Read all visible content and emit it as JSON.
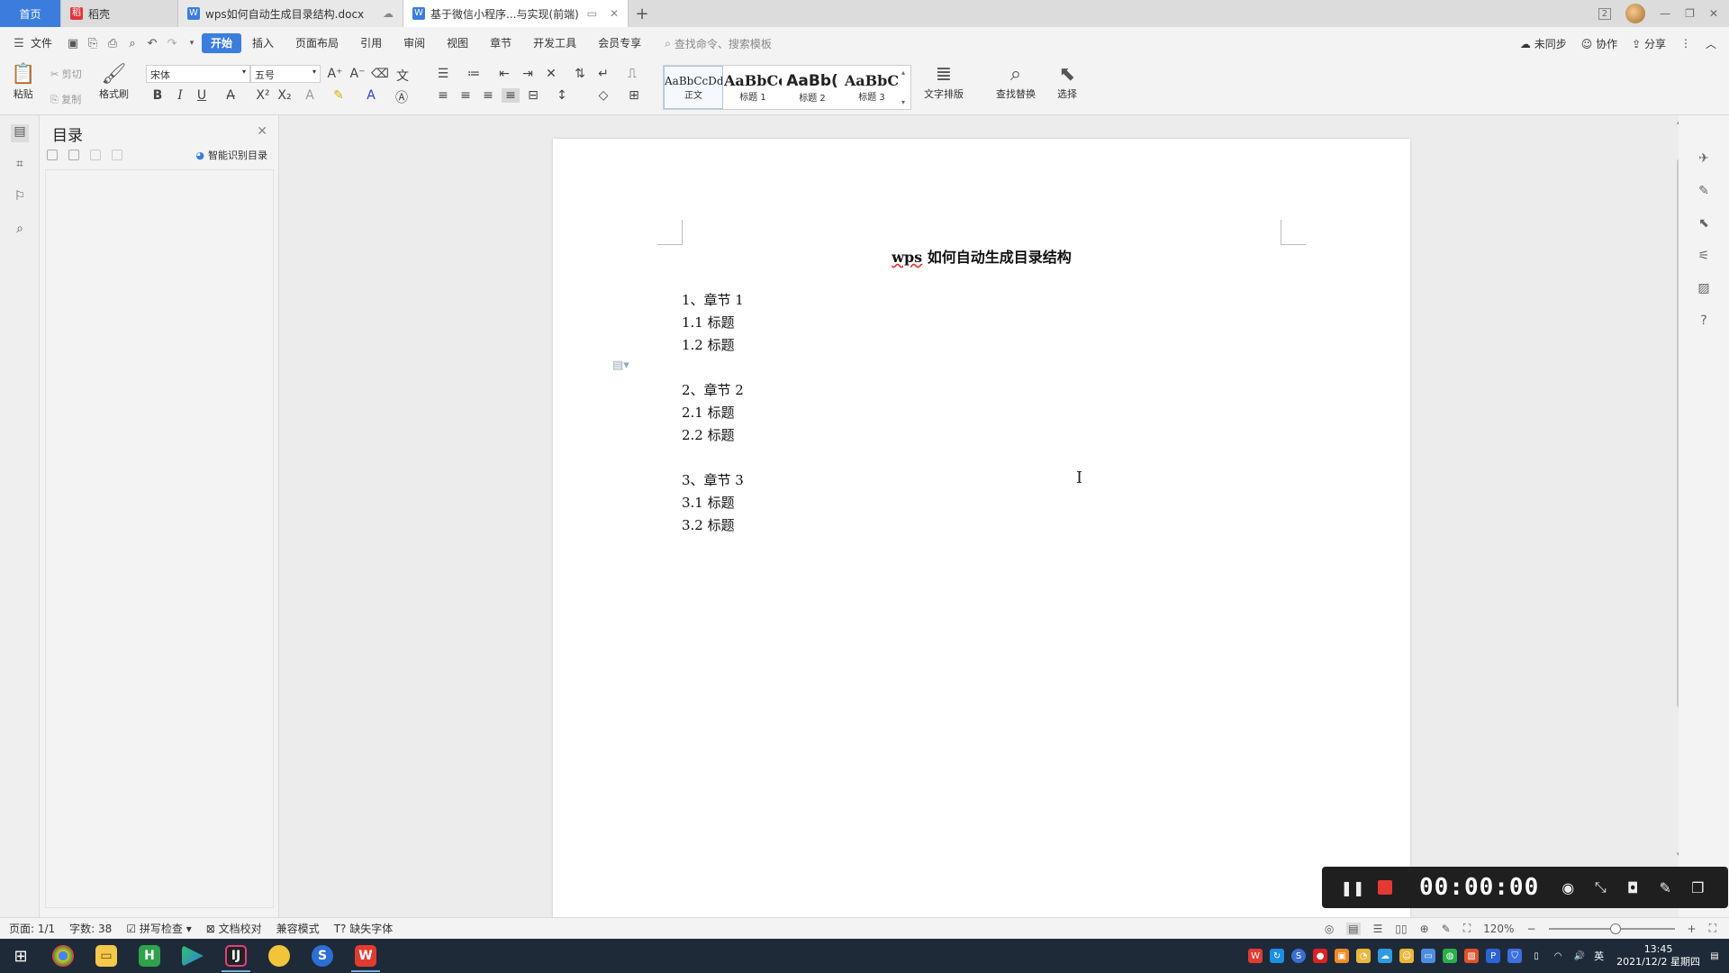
{
  "tabs": [
    {
      "label": "首页"
    },
    {
      "label": "稻壳"
    },
    {
      "label": "wps如何自动生成目录结构.docx"
    },
    {
      "label": "基于微信小程序...与实现(前端)"
    }
  ],
  "titlebar": {
    "badge": "2"
  },
  "menubar": {
    "file": "文件",
    "items": [
      "开始",
      "插入",
      "页面布局",
      "引用",
      "审阅",
      "视图",
      "章节",
      "开发工具",
      "会员专享"
    ],
    "search_placeholder": "查找命令、搜索模板",
    "sync": "未同步",
    "collab": "协作",
    "share": "分享"
  },
  "ribbon": {
    "paste": "粘贴",
    "cut": "剪切",
    "copy": "复制",
    "format_painter": "格式刷",
    "font_name": "宋体",
    "font_size": "五号",
    "styles": [
      {
        "preview": "AaBbCcDd",
        "label": "正文"
      },
      {
        "preview": "AaBbCc",
        "label": "标题 1"
      },
      {
        "preview": "AaBb(",
        "label": "标题 2"
      },
      {
        "preview": "AaBbC",
        "label": "标题 3"
      }
    ],
    "text_layout": "文字排版",
    "find_replace": "查找替换",
    "select": "选择"
  },
  "toc_panel": {
    "title": "目录",
    "smart": "智能识别目录"
  },
  "document": {
    "title_prefix": "wps",
    "title_rest": " 如何自动生成目录结构",
    "lines": [
      "1、章节 1",
      "1.1 标题",
      "1.2 标题",
      "2、章节 2",
      "2.1 标题",
      "2.2 标题",
      "3、章节 3",
      "3.1 标题",
      "3.2 标题"
    ]
  },
  "statusbar": {
    "page": "页面: 1/1",
    "words": "字数: 38",
    "spell": "拼写检查",
    "proof": "文档校对",
    "compat": "兼容模式",
    "missing_font": "缺失字体",
    "zoom": "120%"
  },
  "recorder": {
    "time": "00:00:00"
  },
  "taskbar": {
    "time": "13:45",
    "date": "2021/12/2 星期四",
    "ime": "英"
  }
}
